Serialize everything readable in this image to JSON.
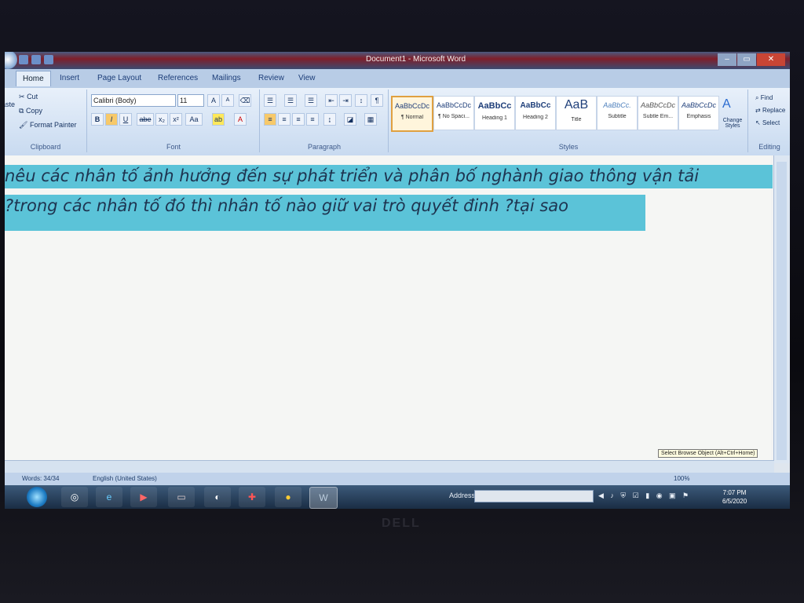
{
  "window": {
    "title": "Document1 - Microsoft Word"
  },
  "tabs": [
    "Home",
    "Insert",
    "Page Layout",
    "References",
    "Mailings",
    "Review",
    "View"
  ],
  "clipboard": {
    "paste": "aste",
    "cut": "Cut",
    "copy": "Copy",
    "format_painter": "Format Painter",
    "label": "Clipboard"
  },
  "font": {
    "name": "Calibri (Body)",
    "size": "11",
    "label": "Font",
    "bold": "B",
    "italic": "I",
    "underline": "U",
    "strike": "abe",
    "sub": "x₂",
    "sup": "x²",
    "case": "Aa",
    "grow": "A",
    "shrink": "A"
  },
  "paragraph": {
    "label": "Paragraph"
  },
  "styles": {
    "label": "Styles",
    "items": [
      {
        "sample": "AaBbCcDc",
        "name": "¶ Normal"
      },
      {
        "sample": "AaBbCcDc",
        "name": "¶ No Spaci..."
      },
      {
        "sample": "AaBbCc",
        "name": "Heading 1"
      },
      {
        "sample": "AaBbCc",
        "name": "Heading 2"
      },
      {
        "sample": "AaB",
        "name": "Title"
      },
      {
        "sample": "AaBbCc.",
        "name": "Subtitle"
      },
      {
        "sample": "AaBbCcDc",
        "name": "Subtle Em..."
      },
      {
        "sample": "AaBbCcDc",
        "name": "Emphasis"
      }
    ],
    "change_styles": "Change Styles"
  },
  "editing": {
    "find": "Find",
    "replace": "Replace",
    "select": "Select",
    "label": "Editing"
  },
  "document": {
    "line1": "nêu các nhân tố ảnh hưởng đến sự phát triển và phân bố nghành giao thông vận tải",
    "line2": "?trong các nhân tố đó thì nhân tố nào giữ vai trò quyết đinh ?tại sao"
  },
  "tooltip": "Select Browse Object (Alt+Ctrl+Home)",
  "status": {
    "words": "Words: 34/34",
    "language": "English (United States)",
    "zoom": "100%"
  },
  "taskbar": {
    "address_label": "Address",
    "time": "7:07 PM",
    "date": "6/5/2020"
  },
  "brand": "DELL"
}
